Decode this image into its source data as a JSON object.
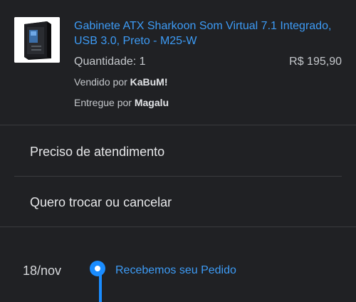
{
  "product": {
    "image_icon": "pc-case-image",
    "title": "Gabinete ATX Sharkoon Som Virtual 7.1 Integrado, USB 3.0, Preto - M25-W",
    "quantity": "Quantidade: 1",
    "price": "R$ 195,90",
    "sold_by_prefix": "Vendido por ",
    "sold_by": "KaBuM!",
    "delivered_by_prefix": "Entregue por ",
    "delivered_by": "Magalu"
  },
  "menu": {
    "items": [
      {
        "label": "Preciso de atendimento"
      },
      {
        "label": "Quero trocar ou cancelar"
      }
    ]
  },
  "timeline": {
    "events": [
      {
        "date": "18/nov",
        "label": "Recebemos seu Pedido"
      }
    ],
    "accent_color": "#1a8cff"
  }
}
